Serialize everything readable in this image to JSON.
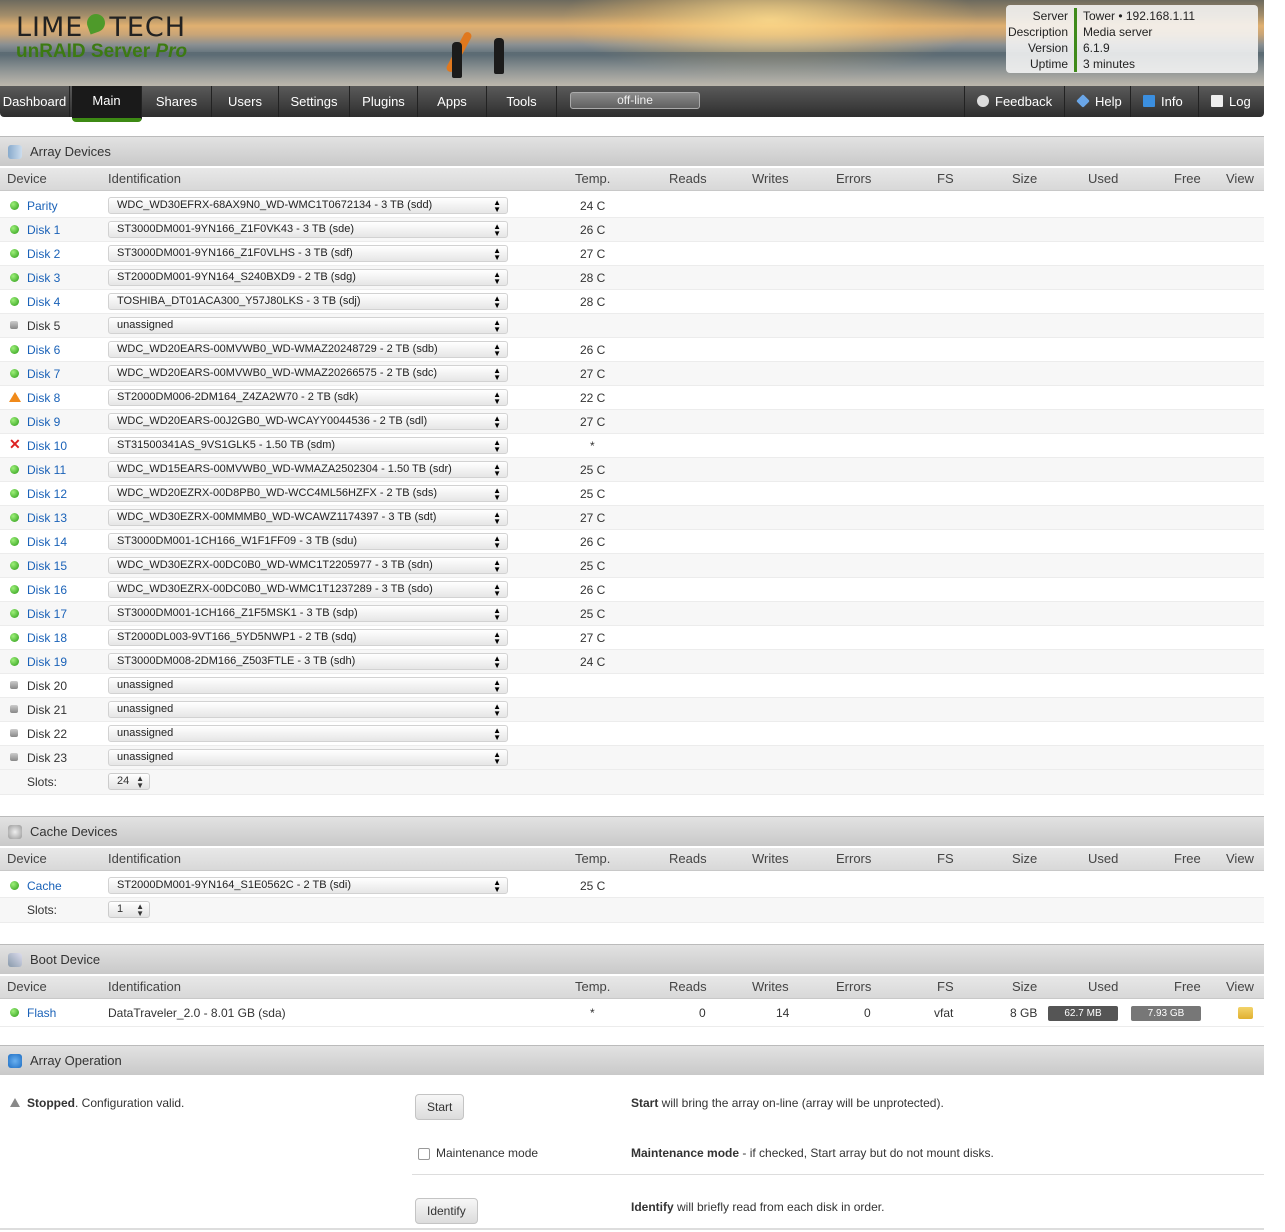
{
  "brand": {
    "logo_left": "LIME",
    "logo_right": "TECH",
    "product": "unRAID Server",
    "edition": "Pro"
  },
  "server_info": [
    {
      "key": "Server",
      "value": "Tower • 192.168.1.11"
    },
    {
      "key": "Description",
      "value": "Media server"
    },
    {
      "key": "Version",
      "value": "6.1.9"
    },
    {
      "key": "Uptime",
      "value": "3 minutes"
    }
  ],
  "nav": {
    "tabs": [
      "Dashboard",
      "Main",
      "Shares",
      "Users",
      "Settings",
      "Plugins",
      "Apps",
      "Tools"
    ],
    "active": "Main",
    "status": "off-line",
    "right": [
      "Feedback",
      "Help",
      "Info",
      "Log"
    ]
  },
  "columns": [
    "Device",
    "Identification",
    "Temp.",
    "Reads",
    "Writes",
    "Errors",
    "FS",
    "Size",
    "Used",
    "Free",
    "View"
  ],
  "array": {
    "title": "Array Devices",
    "rows": [
      {
        "status": "green",
        "name": "Parity",
        "id": "WDC_WD30EFRX-68AX9N0_WD-WMC1T0672134 - 3 TB (sdd)",
        "temp": "24 C"
      },
      {
        "status": "green",
        "name": "Disk 1",
        "id": "ST3000DM001-9YN166_Z1F0VK43 - 3 TB (sde)",
        "temp": "26 C"
      },
      {
        "status": "green",
        "name": "Disk 2",
        "id": "ST3000DM001-9YN166_Z1F0VLHS - 3 TB (sdf)",
        "temp": "27 C"
      },
      {
        "status": "green",
        "name": "Disk 3",
        "id": "ST2000DM001-9YN164_S240BXD9 - 2 TB (sdg)",
        "temp": "28 C"
      },
      {
        "status": "green",
        "name": "Disk 4",
        "id": "TOSHIBA_DT01ACA300_Y57J80LKS - 3 TB (sdj)",
        "temp": "28 C"
      },
      {
        "status": "grey",
        "name": "Disk 5",
        "id": "unassigned",
        "temp": ""
      },
      {
        "status": "green",
        "name": "Disk 6",
        "id": "WDC_WD20EARS-00MVWB0_WD-WMAZ20248729 - 2 TB (sdb)",
        "temp": "26 C"
      },
      {
        "status": "green",
        "name": "Disk 7",
        "id": "WDC_WD20EARS-00MVWB0_WD-WMAZ20266575 - 2 TB (sdc)",
        "temp": "27 C"
      },
      {
        "status": "warn",
        "name": "Disk 8",
        "id": "ST2000DM006-2DM164_Z4ZA2W70 - 2 TB (sdk)",
        "temp": "22 C"
      },
      {
        "status": "green",
        "name": "Disk 9",
        "id": "WDC_WD20EARS-00J2GB0_WD-WCAYY0044536 - 2 TB (sdl)",
        "temp": "27 C"
      },
      {
        "status": "err",
        "name": "Disk 10",
        "id": "ST31500341AS_9VS1GLK5 - 1.50 TB (sdm)",
        "temp": "*"
      },
      {
        "status": "green",
        "name": "Disk 11",
        "id": "WDC_WD15EARS-00MVWB0_WD-WMAZA2502304 - 1.50 TB (sdr)",
        "temp": "25 C"
      },
      {
        "status": "green",
        "name": "Disk 12",
        "id": "WDC_WD20EZRX-00D8PB0_WD-WCC4ML56HZFX - 2 TB (sds)",
        "temp": "25 C"
      },
      {
        "status": "green",
        "name": "Disk 13",
        "id": "WDC_WD30EZRX-00MMMB0_WD-WCAWZ1174397 - 3 TB (sdt)",
        "temp": "27 C"
      },
      {
        "status": "green",
        "name": "Disk 14",
        "id": "ST3000DM001-1CH166_W1F1FF09 - 3 TB (sdu)",
        "temp": "26 C"
      },
      {
        "status": "green",
        "name": "Disk 15",
        "id": "WDC_WD30EZRX-00DC0B0_WD-WMC1T2205977 - 3 TB (sdn)",
        "temp": "25 C"
      },
      {
        "status": "green",
        "name": "Disk 16",
        "id": "WDC_WD30EZRX-00DC0B0_WD-WMC1T1237289 - 3 TB (sdo)",
        "temp": "26 C"
      },
      {
        "status": "green",
        "name": "Disk 17",
        "id": "ST3000DM001-1CH166_Z1F5MSK1 - 3 TB (sdp)",
        "temp": "25 C"
      },
      {
        "status": "green",
        "name": "Disk 18",
        "id": "ST2000DL003-9VT166_5YD5NWP1 - 2 TB (sdq)",
        "temp": "27 C"
      },
      {
        "status": "green",
        "name": "Disk 19",
        "id": "ST3000DM008-2DM166_Z503FTLE - 3 TB (sdh)",
        "temp": "24 C"
      },
      {
        "status": "grey",
        "name": "Disk 20",
        "id": "unassigned",
        "temp": ""
      },
      {
        "status": "grey",
        "name": "Disk 21",
        "id": "unassigned",
        "temp": ""
      },
      {
        "status": "grey",
        "name": "Disk 22",
        "id": "unassigned",
        "temp": ""
      },
      {
        "status": "grey",
        "name": "Disk 23",
        "id": "unassigned",
        "temp": ""
      }
    ],
    "slots_label": "Slots:",
    "slots": "24"
  },
  "cache": {
    "title": "Cache Devices",
    "rows": [
      {
        "status": "green",
        "name": "Cache",
        "id": "ST2000DM001-9YN164_S1E0562C - 2 TB (sdi)",
        "temp": "25 C"
      }
    ],
    "slots_label": "Slots:",
    "slots": "1"
  },
  "boot": {
    "title": "Boot Device",
    "row": {
      "status": "green",
      "name": "Flash",
      "id": "DataTraveler_2.0 - 8.01 GB (sda)",
      "temp": "*",
      "reads": "0",
      "writes": "14",
      "errors": "0",
      "fs": "vfat",
      "size": "8 GB",
      "used": "62.7 MB",
      "free": "7.93 GB"
    }
  },
  "operation": {
    "title": "Array Operation",
    "status_bold": "Stopped",
    "status_rest": ". Configuration valid.",
    "start_btn": "Start",
    "start_desc_bold": "Start",
    "start_desc": " will bring the array on-line (array will be unprotected).",
    "maint_label": "Maintenance mode",
    "maint_desc_bold": "Maintenance mode",
    "maint_desc": " - if checked, Start array but do not mount disks.",
    "identify_btn": "Identify",
    "identify_desc_bold": "Identify",
    "identify_desc": " will briefly read from each disk in order."
  }
}
